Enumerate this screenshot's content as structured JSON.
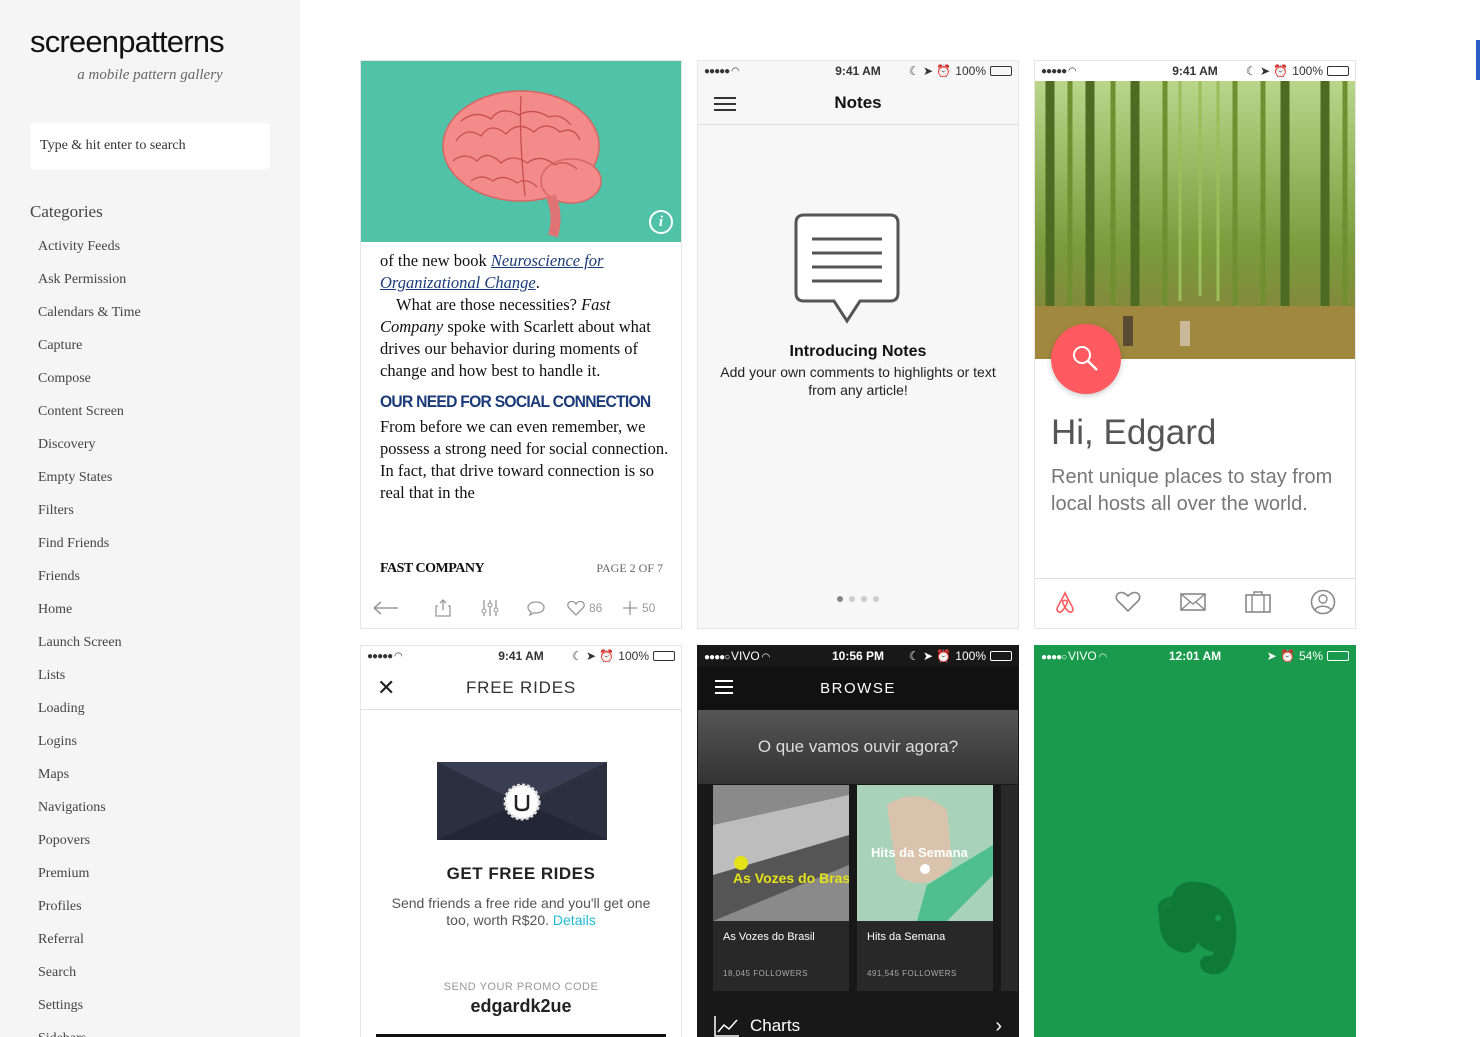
{
  "brand": {
    "name": "screenpatterns",
    "tagline": "a mobile pattern gallery"
  },
  "search": {
    "placeholder": "Type & hit enter to search"
  },
  "categories": {
    "heading": "Categories",
    "items": [
      "Activity Feeds",
      "Ask Permission",
      "Calendars & Time",
      "Capture",
      "Compose",
      "Content Screen",
      "Discovery",
      "Empty States",
      "Filters",
      "Find Friends",
      "Friends",
      "Home",
      "Launch Screen",
      "Lists",
      "Loading",
      "Logins",
      "Maps",
      "Navigations",
      "Popovers",
      "Premium",
      "Profiles",
      "Referral",
      "Search",
      "Settings",
      "Sidebars"
    ]
  },
  "status_bar": {
    "time_941": "9:41 AM",
    "battery": "100%"
  },
  "card_article": {
    "p1_pre": "of the new book ",
    "p1_link": "Neuroscience for Organizational Change",
    "p1_post": ".",
    "p2_pre": "What are those necessities? ",
    "p2_em": "Fast Company",
    "p2_post": " spoke with Scarlett about what drives our behavior during moments of change and how best to handle it.",
    "heading": "OUR NEED FOR SOCIAL CONNECTION",
    "p3": "From before we can even remember, we possess a strong need for social connection. In fact, that drive toward connection is so real that in the",
    "publisher": "FAST COMPANY",
    "page": "PAGE 2 OF 7",
    "likes": "86",
    "adds": "50"
  },
  "card_notes": {
    "nav_title": "Notes",
    "title": "Introducing Notes",
    "subtitle": "Add your own comments to highlights or text from any article!"
  },
  "card_airbnb": {
    "greeting": "Hi, Edgard",
    "tagline": "Rent unique places to stay from local hosts all over the world.",
    "brand_color": "#ff5a5f"
  },
  "card_uber": {
    "nav_title": "FREE RIDES",
    "heading": "GET FREE RIDES",
    "body": "Send friends a free ride and you'll get one too, worth R$20. ",
    "details_link": "Details",
    "promo_label": "SEND YOUR PROMO CODE",
    "promo_code": "edgardk2ue"
  },
  "card_spotify": {
    "carrier": "VIVO",
    "time": "10:56 PM",
    "battery": "100%",
    "nav_title": "BROWSE",
    "prompt": "O que vamos ouvir agora?",
    "playlists": [
      {
        "name": "As Vozes do Brasil",
        "followers": "18,045 FOLLOWERS",
        "art_text": "As Vozes do Brasil"
      },
      {
        "name": "Hits da Semana",
        "followers": "491,545 FOLLOWERS",
        "art_text": "Hits da Semana"
      }
    ],
    "charts_label": "Charts"
  },
  "card_evernote": {
    "carrier": "VIVO",
    "time": "12:01 AM",
    "battery": "54%",
    "bg_color": "#1a9a4c"
  }
}
